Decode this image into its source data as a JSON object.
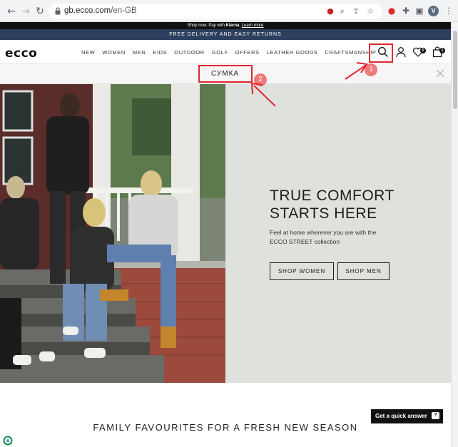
{
  "browser": {
    "url_host": "gb.ecco.com",
    "url_path": "/en-GB",
    "avatar_letter": "V"
  },
  "banners": {
    "klarna_prefix": "Shop now. Pay with",
    "klarna_brand": "Klarna.",
    "klarna_link": "Learn more",
    "delivery": "FREE DELIVERY AND EASY RETURNS"
  },
  "header": {
    "logo": "ecco",
    "nav": [
      "NEW",
      "WOMEN",
      "MEN",
      "KIDS",
      "OUTDOOR",
      "GOLF",
      "OFFERS",
      "LEATHER GOODS",
      "CRAFTSMANSHIP"
    ],
    "wishlist_count": "0",
    "cart_count": "1"
  },
  "search": {
    "value": "СУМКА"
  },
  "hero": {
    "title": "TRUE COMFORT\nSTARTS HERE",
    "description": "Feel at home wherever you are with the\nECCO STREET collection",
    "btn_women": "SHOP WOMEN",
    "btn_men": "SHOP MEN"
  },
  "section_title": "FAMILY FAVOURITES FOR A FRESH NEW SEASON",
  "chat": {
    "label": "Get a quick answer",
    "icon_text": "?"
  },
  "annotations": [
    "1",
    "2"
  ],
  "colors": {
    "delivery_bg": "#2d3f5e",
    "hero_panel_bg": "#dfe2dc",
    "annotation_red": "#e0262e",
    "annotation_badge": "#ef7a7a"
  }
}
